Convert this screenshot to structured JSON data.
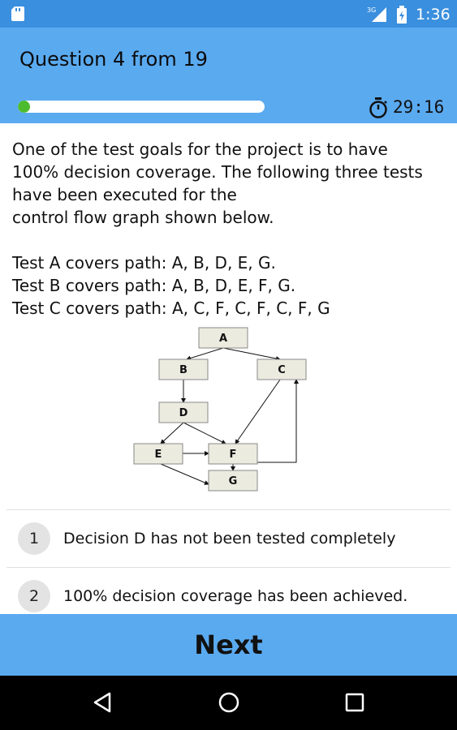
{
  "status_bar": {
    "network": "3G",
    "time": "1:36",
    "icons": [
      "sd-card-icon",
      "signal-icon",
      "battery-icon"
    ]
  },
  "header": {
    "title": "Question 4 from 19",
    "progress_fraction": 0.05,
    "timer": "29:16",
    "timer_icon": "stopwatch-icon"
  },
  "question": {
    "lines": [
      "One of the test goals for the project is to have",
      "100% decision coverage. The following three tests",
      "have been executed for the",
      "control flow graph shown below."
    ],
    "tests": [
      "Test A covers path: A, B, D, E, G.",
      "Test B covers path: A, B, D, E, F, G.",
      "Test C covers path: A, C, F, C, F, C, F, G"
    ]
  },
  "diagram": {
    "nodes": [
      "A",
      "B",
      "C",
      "D",
      "E",
      "F",
      "G"
    ]
  },
  "answers": [
    {
      "number": "1",
      "text": "Decision D has not been tested completely"
    },
    {
      "number": "2",
      "text": "100% decision coverage has been achieved."
    }
  ],
  "actions": {
    "next_label": "Next"
  },
  "colors": {
    "status_bar": "#3a8fde",
    "header": "#5aaaf0",
    "progress": "#4dbb2e",
    "node_fill": "#ecebe0",
    "nav_bar": "#000000"
  }
}
